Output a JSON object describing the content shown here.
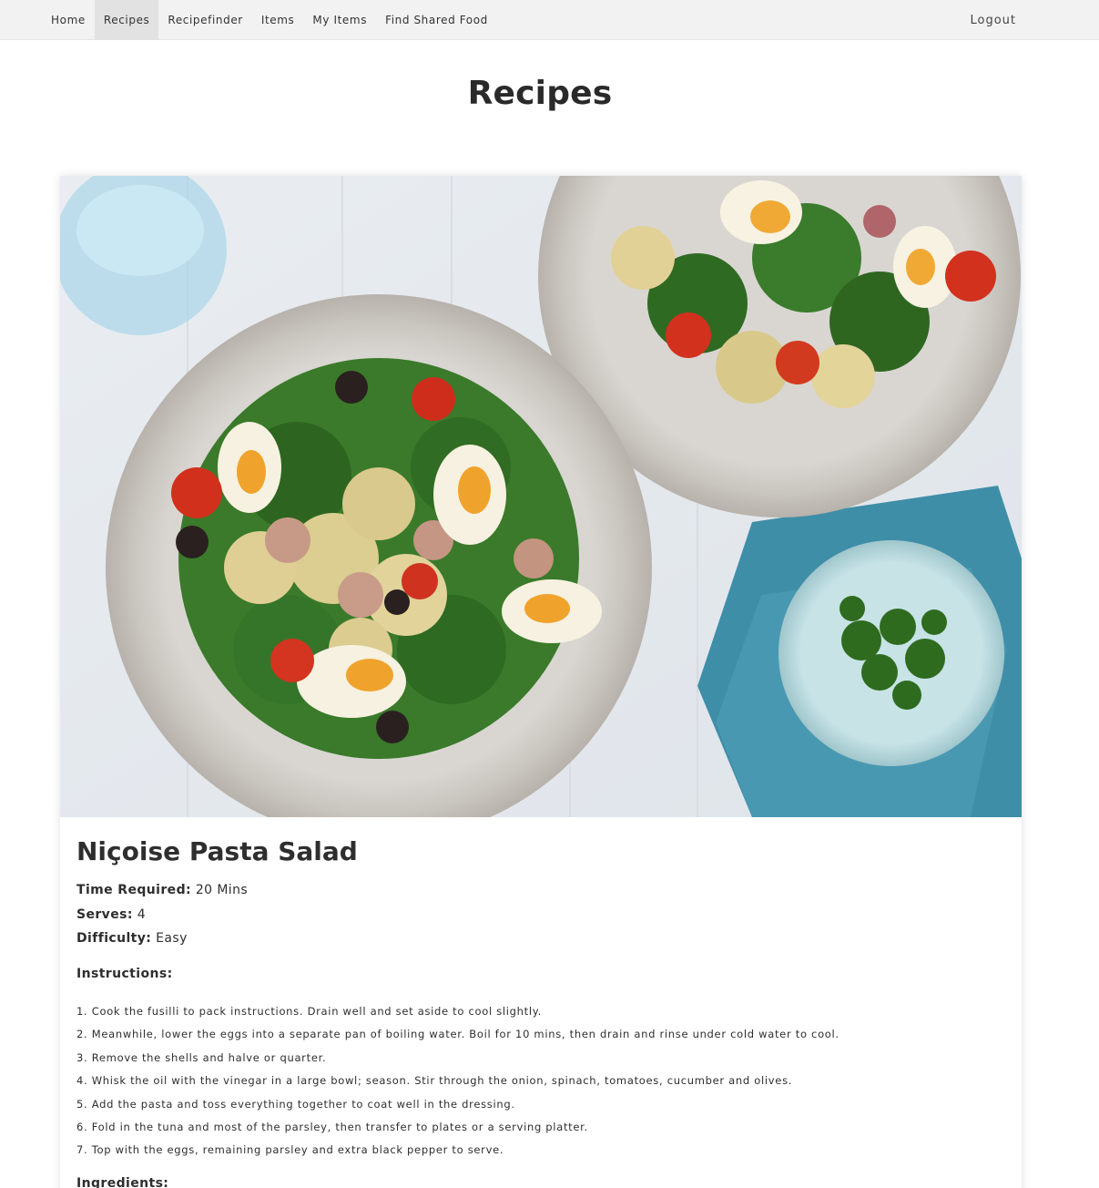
{
  "nav": {
    "items": [
      {
        "label": "Home",
        "active": false
      },
      {
        "label": "Recipes",
        "active": true
      },
      {
        "label": "Recipefinder",
        "active": false
      },
      {
        "label": "Items",
        "active": false
      },
      {
        "label": "My Items",
        "active": false
      },
      {
        "label": "Find Shared Food",
        "active": false
      }
    ],
    "logout_label": "Logout"
  },
  "page": {
    "title": "Recipes"
  },
  "recipe": {
    "name": "Niçoise Pasta Salad",
    "time_label": "Time Required:",
    "time_value": "20 Mins",
    "serves_label": "Serves:",
    "serves_value": "4",
    "difficulty_label": "Difficulty:",
    "difficulty_value": "Easy",
    "instructions_heading": "Instructions:",
    "instructions": [
      "1. Cook the fusilli to pack instructions. Drain well and set aside to cool slightly.",
      "2. Meanwhile, lower the eggs into a separate pan of boiling water. Boil for 10 mins, then drain and rinse under cold water to cool.",
      "3. Remove the shells and halve or quarter.",
      "4. Whisk the oil with the vinegar in a large bowl; season. Stir through the onion, spinach, tomatoes, cucumber and olives.",
      "5. Add the pasta and toss everything together to coat well in the dressing.",
      "6. Fold in the tuna and most of the parsley, then transfer to plates or a serving platter.",
      "7. Top with the eggs, remaining parsley and extra black pepper to serve."
    ],
    "ingredients_heading": "Ingredients:"
  }
}
